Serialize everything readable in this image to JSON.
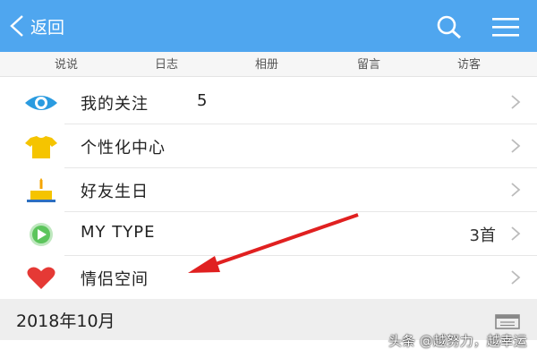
{
  "header": {
    "back_label": "返回"
  },
  "tabs": [
    {
      "label": "说说"
    },
    {
      "label": "日志"
    },
    {
      "label": "相册"
    },
    {
      "label": "留言"
    },
    {
      "label": "访客"
    }
  ],
  "menu": {
    "items": [
      {
        "label": "我的关注",
        "count": "5",
        "icon": "eye-icon"
      },
      {
        "label": "个性化中心",
        "icon": "tshirt-icon"
      },
      {
        "label": "好友生日",
        "icon": "birthday-cake-icon"
      },
      {
        "label": "MY TYPE",
        "value": "3首",
        "icon": "play-icon"
      },
      {
        "label": "情侣空间",
        "icon": "heart-icon"
      }
    ]
  },
  "date_section": {
    "label": "2018年10月"
  },
  "watermark": {
    "text": "头条 @越努力，越幸运"
  },
  "colors": {
    "header_bg": "#4fa6ef",
    "arrow": "#e02020",
    "eye": "#2a9be0",
    "tshirt": "#f5c400",
    "heart": "#e53935",
    "play": "#5cc55c"
  }
}
